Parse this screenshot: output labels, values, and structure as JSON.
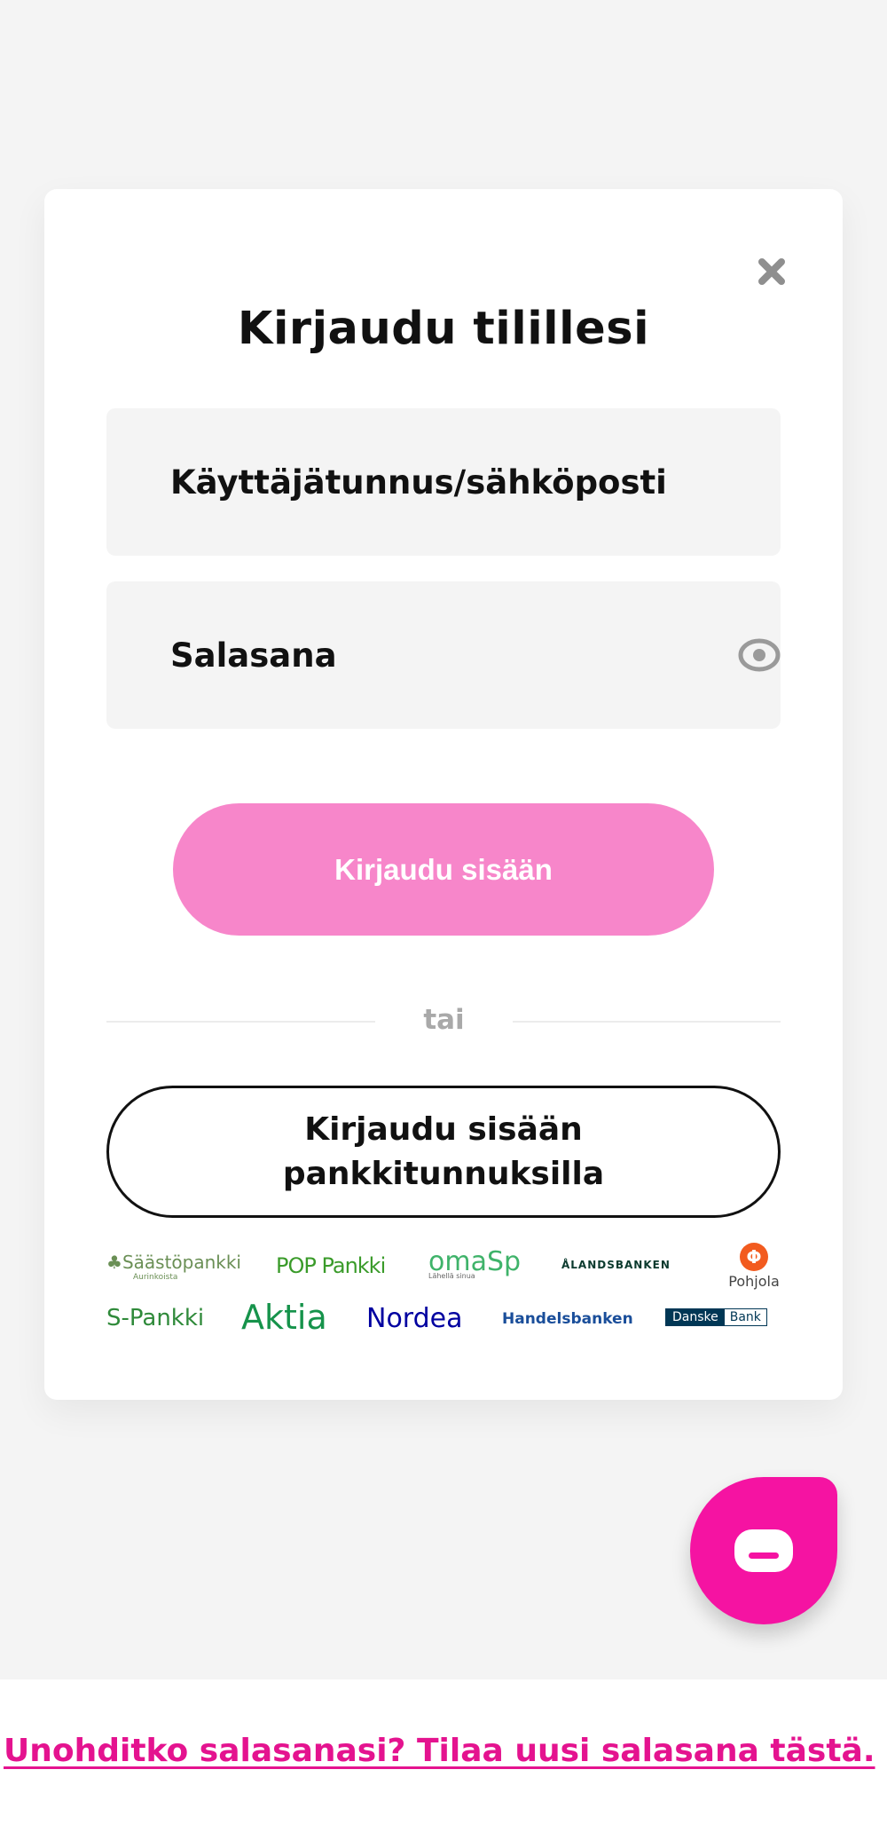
{
  "modal": {
    "title": "Kirjaudu tilillesi",
    "username_placeholder": "Käyttäjätunnus/sähköposti",
    "password_placeholder": "Salasana",
    "login_button": "Kirjaudu sisään",
    "divider": "tai",
    "bank_login_line1": "Kirjaudu sisään",
    "bank_login_line2": "pankkitunnuksilla",
    "close_icon": "close-icon",
    "eye_icon": "eye-icon"
  },
  "banks": {
    "saastopankki": "Säästöpankki",
    "saastopankki_sub": "Aurinkoista",
    "pop": "POP Pankki",
    "oma": "omaSp",
    "oma_sub": "Lähellä sinua",
    "alands": "ÅLANDSBANKEN",
    "pohjola": "Pohjola",
    "spankki": "S-Pankki",
    "aktia": "Aktia",
    "nordea": "Nordea",
    "handelsbanken": "Handelsbanken",
    "danske_1": "Danske",
    "danske_2": "Bank"
  },
  "footer": {
    "forgot_link": "Unohditko salasanasi? Tilaa uusi salasana tästä."
  },
  "colors": {
    "accent": "#f513a2",
    "login_button": "#f786ca",
    "link": "#e4138f"
  },
  "chat": {
    "icon": "chat-icon"
  }
}
